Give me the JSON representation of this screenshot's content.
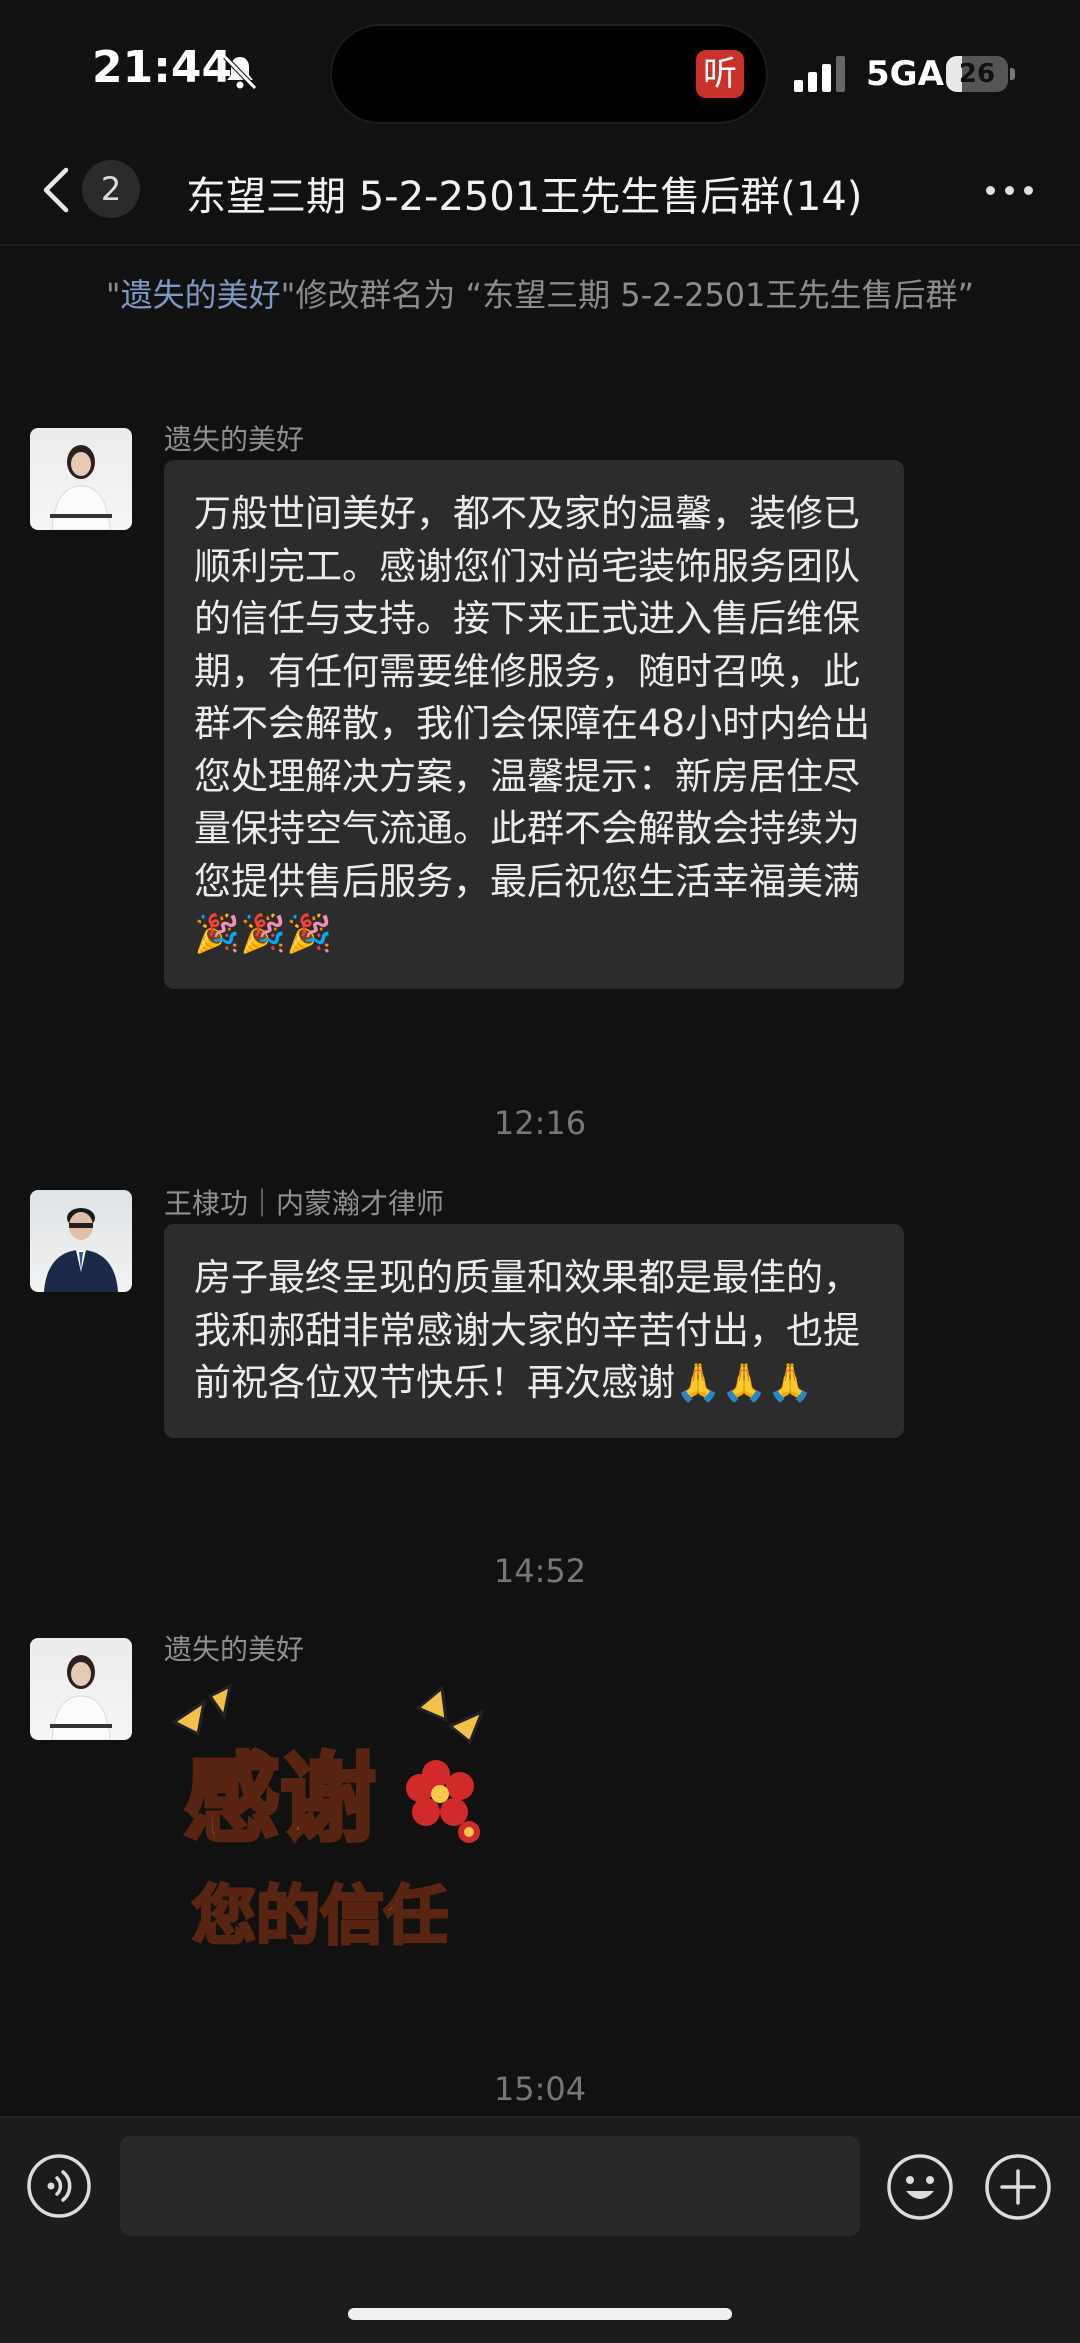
{
  "status_bar": {
    "time": "21:44",
    "network": "5GA",
    "battery_level": "26",
    "listen_app_glyph": "听",
    "icons": [
      "bell-muted-icon",
      "signal-icon",
      "battery-icon"
    ]
  },
  "header": {
    "unread_count": "2",
    "title": "东望三期 5-2-2501王先生售后群(14)"
  },
  "system_notice": {
    "quote_open": "\"",
    "actor": "遗失的美好",
    "text": "\"修改群名为 “东望三期 5-2-2501王先生售后群”"
  },
  "messages": [
    {
      "sender": "遗失的美好",
      "text": "万般世间美好，都不及家的温馨，装修已顺利完工。感谢您们对尚宅装饰服务团队的信任与支持。接下来正式进入售后维保期，有任何需要维修服务，随时召唤，此群不会解散，我们会保障在48小时内给出您处理解决方案，温馨提示：新房居住尽量保持空气流通。此群不会解散会持续为您提供售后服务，最后祝您生活幸福美满🎉🎉🎉"
    },
    {
      "timestamp": "12:16"
    },
    {
      "sender": "王棣功｜内蒙瀚才律师",
      "text": "房子最终呈现的质量和效果都是最佳的，我和郝甜非常感谢大家的辛苦付出，也提前祝各位双节快乐！再次感谢🙏🙏🙏"
    },
    {
      "timestamp": "14:52"
    },
    {
      "sender": "遗失的美好",
      "sticker_line1": "感谢",
      "sticker_line2": "您的信任"
    },
    {
      "timestamp": "15:04"
    }
  ],
  "input_bar": {
    "placeholder": "",
    "icons": [
      "voice-icon",
      "emoji-icon",
      "add-icon"
    ]
  },
  "colors": {
    "background": "#111111",
    "bubble": "#2c2c2c",
    "highlight_name": "#7f97c3",
    "badge_red": "#c8322a"
  }
}
